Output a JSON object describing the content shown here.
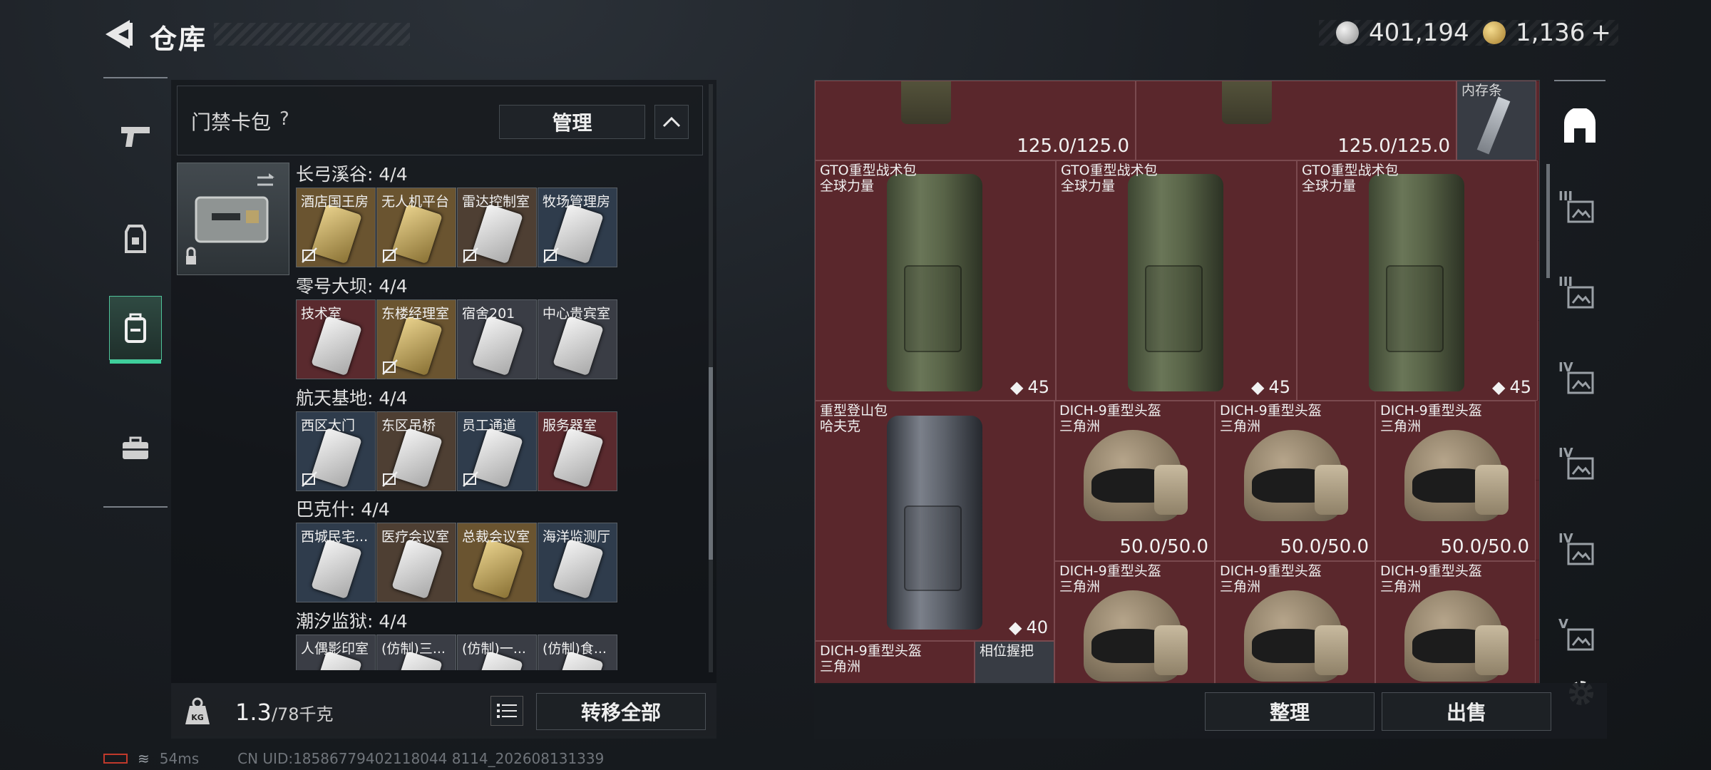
{
  "header": {
    "title": "仓库",
    "back_icon": "chevron-left-icon"
  },
  "currency": {
    "silver": "401,194",
    "gold": "1,136",
    "add_label": "+"
  },
  "left_nav": [
    {
      "icon": "pistol-icon",
      "active": false
    },
    {
      "icon": "vest-icon",
      "active": false
    },
    {
      "icon": "backpack-icon",
      "active": true
    },
    {
      "icon": "briefcase-icon",
      "active": false
    }
  ],
  "card_pack": {
    "label": "门禁卡包",
    "help": "?",
    "manage_label": "管理"
  },
  "sections": [
    {
      "title": "长弓溪谷: 4/4",
      "cards": [
        {
          "name": "酒店国王房",
          "bg": "gold",
          "card": "gold",
          "locked": true
        },
        {
          "name": "无人机平台",
          "bg": "gold",
          "card": "gold",
          "locked": true
        },
        {
          "name": "雷达控制室",
          "bg": "brown",
          "card": "white",
          "locked": true
        },
        {
          "name": "牧场管理房",
          "bg": "blue",
          "card": "white",
          "locked": true
        }
      ]
    },
    {
      "title": "零号大坝: 4/4",
      "cards": [
        {
          "name": "技术室",
          "bg": "red",
          "card": "white",
          "locked": false
        },
        {
          "name": "东楼经理室",
          "bg": "gold",
          "card": "gold",
          "locked": true
        },
        {
          "name": "宿舍201",
          "bg": "gray",
          "card": "white",
          "locked": false
        },
        {
          "name": "中心贵宾室",
          "bg": "gray",
          "card": "white",
          "locked": false
        }
      ]
    },
    {
      "title": "航天基地: 4/4",
      "cards": [
        {
          "name": "西区大门",
          "bg": "blue",
          "card": "white",
          "locked": true
        },
        {
          "name": "东区吊桥",
          "bg": "brown",
          "card": "white",
          "locked": true
        },
        {
          "name": "员工通道",
          "bg": "blue",
          "card": "white",
          "locked": true
        },
        {
          "name": "服务器室",
          "bg": "red",
          "card": "white",
          "locked": false
        }
      ]
    },
    {
      "title": "巴克什: 4/4",
      "cards": [
        {
          "name": "西城民宅...",
          "bg": "blue",
          "card": "white",
          "locked": false
        },
        {
          "name": "医疗会议室",
          "bg": "brown",
          "card": "white",
          "locked": false
        },
        {
          "name": "总裁会议室",
          "bg": "gold",
          "card": "gold",
          "locked": false
        },
        {
          "name": "海洋监测厅",
          "bg": "blue",
          "card": "white",
          "locked": false
        }
      ]
    },
    {
      "title": "潮汐监狱: 4/4",
      "cards": [
        {
          "name": "人偶影印室",
          "bg": "gray",
          "card": "white",
          "locked": false
        },
        {
          "name": "(仿制)三...",
          "bg": "gray",
          "card": "white",
          "locked": false
        },
        {
          "name": "(仿制)一...",
          "bg": "gray",
          "card": "white",
          "locked": false
        },
        {
          "name": "(仿制)食...",
          "bg": "gray",
          "card": "white",
          "locked": false
        }
      ]
    }
  ],
  "weight": {
    "current": "1.3",
    "max": "/78千克",
    "icon": "kg-weight-icon"
  },
  "transfer_all_label": "转移全部",
  "stash": {
    "top_durability_1": "125.0/125.0",
    "top_durability_2": "125.0/125.0",
    "top_item_label": "内存条",
    "backpacks": [
      {
        "name": "GTO重型战术包",
        "sub": "全球力量",
        "cap": "45"
      },
      {
        "name": "GTO重型战术包",
        "sub": "全球力量",
        "cap": "45"
      },
      {
        "name": "GTO重型战术包",
        "sub": "全球力量",
        "cap": "45"
      }
    ],
    "hiking_pack": {
      "name": "重型登山包",
      "sub": "哈夫克",
      "cap": "40"
    },
    "helmets_row1": [
      {
        "name": "DICH-9重型头盔",
        "sub": "三角洲",
        "dura": "50.0/50.0"
      },
      {
        "name": "DICH-9重型头盔",
        "sub": "三角洲",
        "dura": "50.0/50.0"
      },
      {
        "name": "DICH-9重型头盔",
        "sub": "三角洲",
        "dura": "50.0/50.0"
      }
    ],
    "helmets_row2": [
      {
        "name": "DICH-9重型头盔",
        "sub": "三角洲"
      },
      {
        "name": "DICH-9重型头盔",
        "sub": "三角洲"
      },
      {
        "name": "DICH-9重型头盔",
        "sub": "三角洲"
      }
    ],
    "bottom_helmet": {
      "name": "DICH-9重型头盔",
      "sub": "三角洲"
    },
    "bottom_item": {
      "name": "相位握把"
    }
  },
  "right_toolbar": [
    {
      "icon": "stash-home-icon",
      "label": ""
    },
    {
      "icon": "stash-tier-3a-icon",
      "label": "III"
    },
    {
      "icon": "stash-tier-3b-icon",
      "label": "III"
    },
    {
      "icon": "stash-tier-4-add-icon",
      "label": "IV"
    },
    {
      "icon": "stash-tier-4-folder-icon",
      "label": "IV"
    },
    {
      "icon": "stash-tier-4-locked-icon",
      "label": "IV"
    },
    {
      "icon": "stash-tier-5-locked-icon",
      "label": "V"
    }
  ],
  "sort_label": "整理",
  "sell_label": "出售",
  "status": {
    "ping": "54ms",
    "uid": "CN UID:18586779402118044 8114_202608131339"
  }
}
